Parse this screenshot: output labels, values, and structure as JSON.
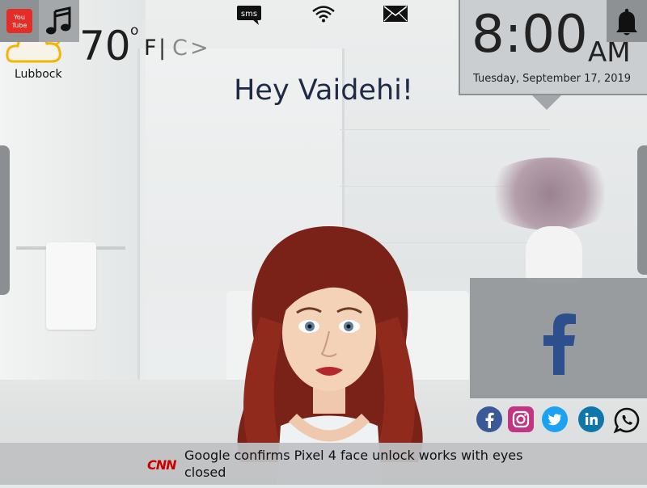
{
  "status_icons": {
    "sms_label": "sms",
    "icons": [
      "sms-icon",
      "wifi-icon",
      "mail-icon"
    ]
  },
  "weather": {
    "temperature": "70",
    "degree_symbol": "o",
    "unit_f": "F",
    "unit_separator": "|",
    "unit_c": "C",
    "unit_toggle": ">",
    "city": "Lubbock",
    "icon": "partly-cloudy-icon"
  },
  "greeting": "Hey Vaidehi!",
  "clock": {
    "time": "8:00",
    "ampm": "AM",
    "date": "Tuesday, September 17, 2019"
  },
  "social": {
    "featured": "facebook-icon",
    "icons": [
      "facebook-icon",
      "instagram-icon",
      "twitter-icon",
      "linkedin-icon",
      "whatsapp-icon"
    ]
  },
  "news": {
    "source": "CNN",
    "headline": "Google confirms Pixel 4 face unlock works with eyes closed"
  },
  "bottom_buttons": {
    "youtube_label": "You Tube",
    "icons": [
      "youtube-icon",
      "music-note-icon",
      "bell-icon"
    ]
  },
  "colors": {
    "greeting": "#1f2a44",
    "facebook": "#2d4f8e",
    "instagram": "#c13584",
    "twitter": "#1da1f2",
    "linkedin": "#0e76a8",
    "cnn": "#cc0000",
    "panel": "#878b8e"
  }
}
